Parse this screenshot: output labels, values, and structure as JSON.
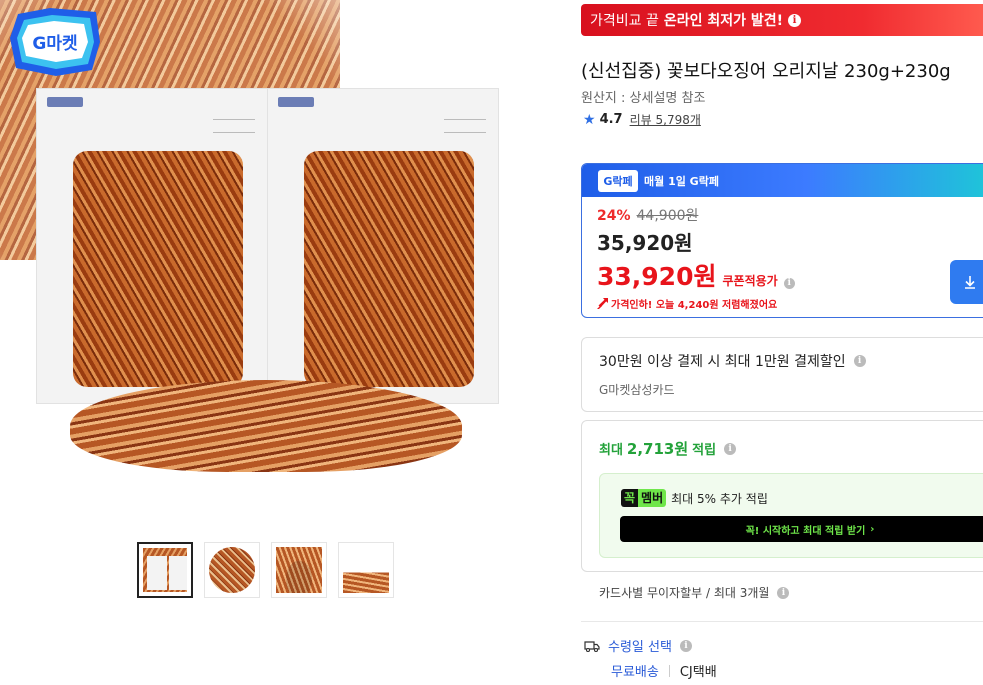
{
  "gallery": {
    "badge_text": "G마켓",
    "thumbnails": [
      "thumbnail-1",
      "thumbnail-2",
      "thumbnail-3",
      "thumbnail-4"
    ]
  },
  "promo": {
    "prefix": "가격비교 끝",
    "highlight": "온라인 최저가 발견!",
    "icon": "info-icon"
  },
  "product": {
    "title": "(신선집중) 꽃보다오징어 오리지날 230g+230g",
    "origin": "원산지 : 상세설명 참조",
    "rating": "4.7",
    "review_label": "리뷰 5,798개"
  },
  "price": {
    "header_badge": "G락페",
    "header_text": "매월 1일 G락페",
    "discount_rate": "24%",
    "original_price": "44,900원",
    "sale_price": "35,920원",
    "coupon_price": "33,920원",
    "coupon_label": "쿠폰적용가",
    "drop_text": "가격인하! 오늘 4,240원 저렴해졌어요",
    "download_icon": "download-icon"
  },
  "card_discount": {
    "title": "30만원 이상 결제 시 최대 1만원 결제할인",
    "card_name": "G마켓삼성카드"
  },
  "points": {
    "prefix": "최대",
    "amount": "2,713원",
    "suffix": "적립",
    "member_badge_a": "꼭",
    "member_badge_b": "멤버",
    "member_text": "최대 5% 추가 적립",
    "cta_label": "꼭! 시작하고 최대 적립 받기",
    "cta_arrow": "›"
  },
  "installment": {
    "text": "카드사별 무이자할부 / 최대 3개월"
  },
  "delivery": {
    "label": "수령일 선택",
    "free_shipping": "무료배송",
    "carrier": "CJ택배"
  },
  "colors": {
    "promo_red": "#e01b26",
    "price_red": "#e8141b",
    "accent_blue": "#2f6fe4",
    "points_green": "#23a23a",
    "member_green": "#6fe64a"
  }
}
